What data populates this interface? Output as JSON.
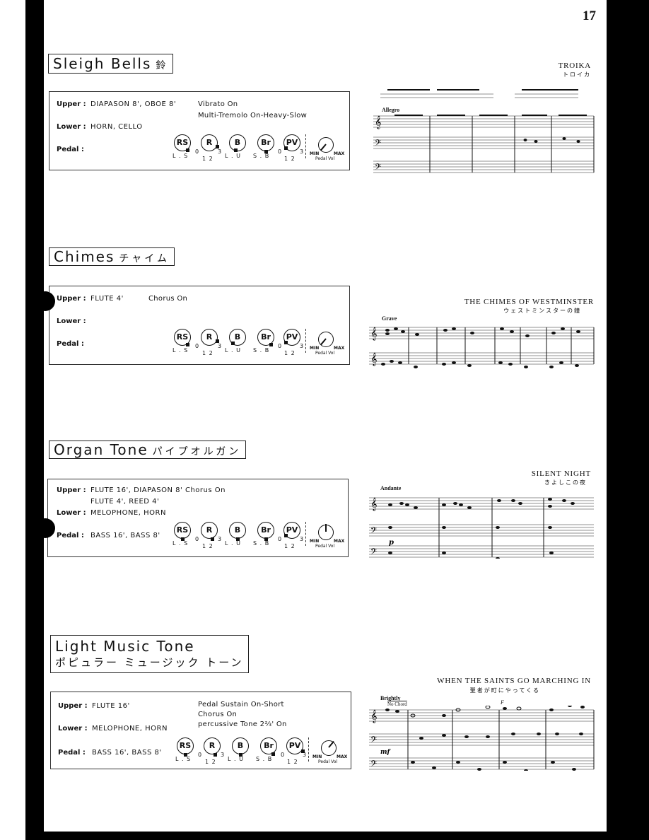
{
  "page": {
    "number": "17"
  },
  "sections": [
    {
      "title_en": "Sleigh Bells",
      "title_jp": "鈴",
      "upper": "DIAPASON 8', OBOE 8'",
      "upper2": "",
      "lower": "HORN, CELLO",
      "pedal": "",
      "effects": [
        "Vibrato  On",
        "Multi-Tremolo  On-Heavy-Slow"
      ],
      "settings": {
        "RS": "S",
        "R": "3",
        "B": "L",
        "Br": "S/B center",
        "PV": "0",
        "pedal_vol": "MIN"
      },
      "song": {
        "title": "TROIKA",
        "title_jp": "トロイカ",
        "tempo": "Allegro"
      }
    },
    {
      "title_en": "Chimes",
      "title_jp": "チャイム",
      "upper": "FLUTE 4'",
      "upper2": "",
      "lower": "",
      "pedal": "",
      "effects": [
        "Chorus  On"
      ],
      "settings": {
        "RS": "S",
        "R": "3",
        "B": "L",
        "Br": "B",
        "PV": "0",
        "pedal_vol": "MIN"
      },
      "song": {
        "title": "THE CHIMES OF WESTMINSTER",
        "title_jp": "ウェストミンスターの鐘",
        "tempo": "Grave"
      }
    },
    {
      "title_en": "Organ Tone",
      "title_jp": "パイプオルガン",
      "upper": "FLUTE 16', DIAPASON 8'  Chorus  On",
      "upper2": "FLUTE 4', REED 4'",
      "lower": "MELOPHONE, HORN",
      "pedal": "BASS 16', BASS 8'",
      "effects": [],
      "settings": {
        "RS": "center",
        "R": "2",
        "B": "center",
        "Br": "center",
        "PV": "0",
        "pedal_vol": "mid"
      },
      "song": {
        "title": "SILENT NIGHT",
        "title_jp": "きよしこの夜",
        "tempo": "Andante"
      }
    },
    {
      "title_en": "Light Music Tone",
      "title_jp": "ポピュラー  ミュージック  トーン",
      "upper": "FLUTE 16'",
      "upper2": "",
      "lower": "MELOPHONE, HORN",
      "pedal": "BASS 16', BASS 8'",
      "effects": [
        "Pedal  Sustain  On-Short",
        "Chorus  On",
        "percussive Tone  2⅔'  On"
      ],
      "settings": {
        "RS": "center",
        "R": "2",
        "B": "center",
        "Br": "B",
        "PV": "3",
        "pedal_vol": "MAX"
      },
      "song": {
        "title": "WHEN THE SAINTS GO MARCHING IN",
        "title_jp": "聖者が町にやってくる",
        "tempo": "Brightly",
        "chord_note": "No Chord",
        "chord": "F"
      }
    }
  ],
  "labels": {
    "upper": "Upper :",
    "lower": "Lower :",
    "pedal": "Pedal :",
    "knobs": [
      "RS",
      "R",
      "B",
      "Br",
      "PV"
    ],
    "rs_scale": "L . S",
    "r_scale_0": "0",
    "r_scale": "1 2",
    "r_scale_3": "3",
    "b_scale": "L . U",
    "br_scale": "S . B",
    "pv_scale_0": "0",
    "pv_scale": "1 2",
    "pv_scale_3": "3",
    "min": "MIN",
    "max": "MAX",
    "pedal_vol": "Pedal Vol"
  }
}
